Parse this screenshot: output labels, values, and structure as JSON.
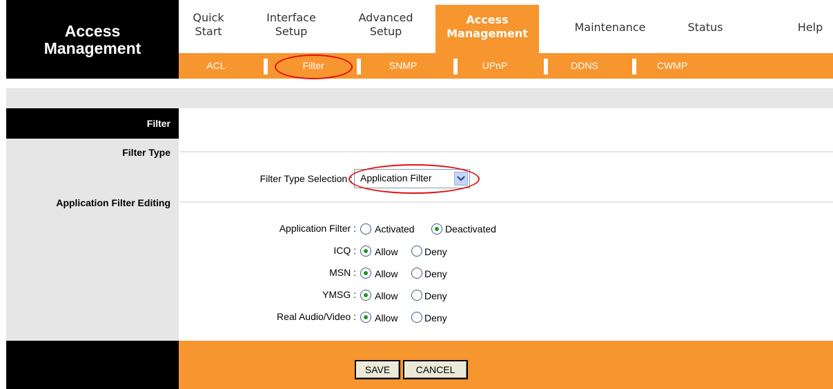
{
  "brand": {
    "title_line1": "Access",
    "title_line2": "Management"
  },
  "topnav": {
    "items": [
      {
        "line1": "Quick",
        "line2": "Start"
      },
      {
        "line1": "Interface",
        "line2": "Setup"
      },
      {
        "line1": "Advanced",
        "line2": "Setup"
      },
      {
        "line1": "Access",
        "line2": "Management"
      },
      {
        "label": "Maintenance"
      },
      {
        "label": "Status"
      },
      {
        "label": "Help"
      }
    ],
    "active_index": 3
  },
  "subnav": {
    "items": [
      "ACL",
      "Filter",
      "SNMP",
      "UPnP",
      "DDNS",
      "CWMP"
    ],
    "active": "Filter"
  },
  "sections": {
    "filter": "Filter",
    "filter_type": "Filter Type",
    "app_filter_editing": "Application Filter Editing"
  },
  "filter_type_selection": {
    "label": "Filter Type Selection :",
    "value": "Application Filter"
  },
  "app_filter": {
    "rows": [
      {
        "label": "Application Filter :",
        "options": [
          "Activated",
          "Deactivated"
        ],
        "selected": "Deactivated"
      },
      {
        "label": "ICQ :",
        "options": [
          "Allow",
          "Deny"
        ],
        "selected": "Allow"
      },
      {
        "label": "MSN :",
        "options": [
          "Allow",
          "Deny"
        ],
        "selected": "Allow"
      },
      {
        "label": "YMSG :",
        "options": [
          "Allow",
          "Deny"
        ],
        "selected": "Allow"
      },
      {
        "label": "Real Audio/Video :",
        "options": [
          "Allow",
          "Deny"
        ],
        "selected": "Allow"
      }
    ]
  },
  "footer": {
    "save_label": "SAVE",
    "cancel_label": "CANCEL"
  },
  "colors": {
    "accent": "#f7952e",
    "header_black": "#000000",
    "panel_gray": "#e6e6e6",
    "annotation_red": "#e01010"
  }
}
